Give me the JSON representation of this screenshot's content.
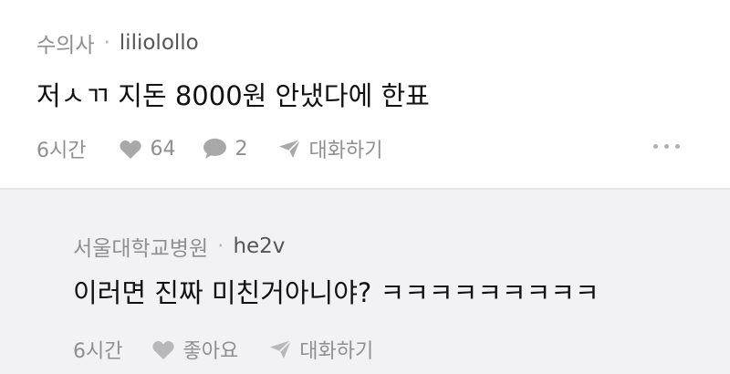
{
  "post": {
    "board": "수의사",
    "separator": "·",
    "nickname": "liliolollo",
    "text": "저ㅅㄲ 지돈 8000원 안냈다에 한표",
    "time": "6시간",
    "likes": "64",
    "comments": "2",
    "reply_label": "대화하기"
  },
  "reply": {
    "board": "서울대학교병원",
    "separator": "·",
    "nickname": "he2v",
    "text": "이러면 진짜 미친거아니야? ㅋㅋㅋㅋㅋㅋㅋㅋㅋ",
    "time": "6시간",
    "like_label": "좋아요",
    "reply_label": "대화하기"
  },
  "icons": {
    "heart": "heart-icon",
    "comment": "comment-icon",
    "send": "send-icon",
    "more": "more-icon"
  },
  "colors": {
    "meta_gray": "#8f8f8f",
    "icon_gray": "#a8a8a8",
    "reply_background": "#f2f2f4"
  }
}
